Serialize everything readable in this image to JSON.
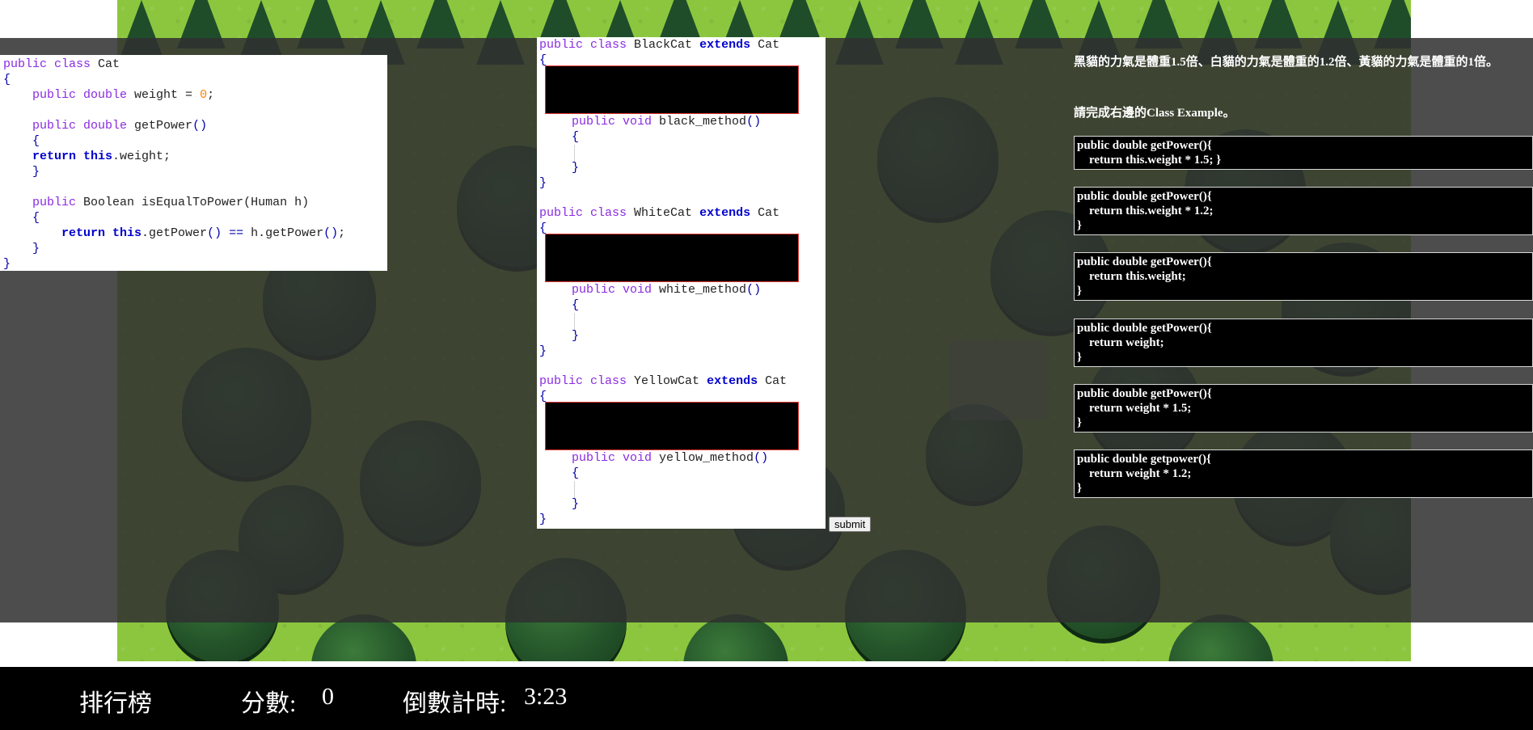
{
  "base_class": {
    "lines": [
      {
        "parts": [
          {
            "t": "public class ",
            "c": "kw"
          },
          {
            "t": "Cat",
            "c": ""
          }
        ]
      },
      {
        "parts": [
          {
            "t": "{",
            "c": "brace"
          }
        ]
      },
      {
        "parts": [
          {
            "t": "    ",
            "c": ""
          },
          {
            "t": "public double ",
            "c": "kw"
          },
          {
            "t": "weight = ",
            "c": ""
          },
          {
            "t": "0",
            "c": "num"
          },
          {
            "t": ";",
            "c": ""
          }
        ]
      },
      {
        "parts": [
          {
            "t": "",
            "c": ""
          }
        ]
      },
      {
        "parts": [
          {
            "t": "    ",
            "c": ""
          },
          {
            "t": "public double ",
            "c": "kw"
          },
          {
            "t": "getPower",
            "c": ""
          },
          {
            "t": "()",
            "c": "brace"
          }
        ]
      },
      {
        "parts": [
          {
            "t": "    ",
            "c": ""
          },
          {
            "t": "{",
            "c": "brace"
          }
        ]
      },
      {
        "parts": [
          {
            "t": "    ",
            "c": ""
          },
          {
            "t": "return this",
            "c": "kw2"
          },
          {
            "t": ".weight;",
            "c": ""
          }
        ]
      },
      {
        "parts": [
          {
            "t": "    ",
            "c": ""
          },
          {
            "t": "}",
            "c": "brace"
          }
        ]
      },
      {
        "parts": [
          {
            "t": "",
            "c": ""
          }
        ]
      },
      {
        "parts": [
          {
            "t": "    ",
            "c": ""
          },
          {
            "t": "public ",
            "c": "kw"
          },
          {
            "t": "Boolean isEqualToPower(Human h)",
            "c": ""
          }
        ]
      },
      {
        "parts": [
          {
            "t": "    ",
            "c": ""
          },
          {
            "t": "{",
            "c": "brace"
          }
        ]
      },
      {
        "parts": [
          {
            "t": "        ",
            "c": ""
          },
          {
            "t": "return this",
            "c": "kw2"
          },
          {
            "t": ".getPower",
            "c": ""
          },
          {
            "t": "()",
            "c": "brace"
          },
          {
            "t": " ",
            "c": ""
          },
          {
            "t": "==",
            "c": "brace"
          },
          {
            "t": " h.getPower",
            "c": ""
          },
          {
            "t": "()",
            "c": "brace"
          },
          {
            "t": ";",
            "c": ""
          }
        ]
      },
      {
        "parts": [
          {
            "t": "    ",
            "c": ""
          },
          {
            "t": "}",
            "c": "brace"
          }
        ]
      },
      {
        "parts": [
          {
            "t": "}",
            "c": "brace"
          }
        ]
      }
    ]
  },
  "subclasses": [
    {
      "class_kw": "public class ",
      "name": "BlackCat",
      "extends_kw": "extends",
      "parent": "Cat",
      "method_kw": "public void ",
      "method": "black_method",
      "parens": "()"
    },
    {
      "class_kw": "public class ",
      "name": "WhiteCat",
      "extends_kw": "extends",
      "parent": "Cat",
      "method_kw": "public void ",
      "method": "white_method",
      "parens": "()"
    },
    {
      "class_kw": "public class ",
      "name": "YellowCat",
      "extends_kw": "extends",
      "parent": "Cat",
      "method_kw": "public void ",
      "method": "yellow_method",
      "parens": "()"
    }
  ],
  "submit_label": "submit",
  "instructions": {
    "description": "黑貓的力氣是體重1.5倍、白貓的力氣是體重的1.2倍、黃貓的力氣是體重的1倍。",
    "task": "請完成右邊的Class Example。"
  },
  "options": [
    {
      "lines": [
        "public double getPower(){",
        "    return this.weight * 1.5; }"
      ]
    },
    {
      "lines": [
        "public double getPower(){",
        "    return this.weight * 1.2;",
        "}"
      ]
    },
    {
      "lines": [
        "public double getPower(){",
        "    return this.weight;",
        "}"
      ]
    },
    {
      "lines": [
        "public double getPower(){",
        "    return weight;",
        "}"
      ]
    },
    {
      "lines": [
        "public double getPower(){",
        "    return weight * 1.5;",
        "}"
      ]
    },
    {
      "lines": [
        "public double getpower(){",
        "    return weight * 1.2;",
        "}"
      ]
    }
  ],
  "bottom_bar": {
    "leaderboard_label": "排行榜",
    "score_label": "分數:",
    "score_value": "0",
    "countdown_label": "倒數計時:",
    "countdown_value": "3:23"
  },
  "colors": {
    "overlay": "#303030",
    "keyword": "#8a2be2",
    "keyword_bold": "#0000cc",
    "number": "#ff7f00",
    "drop_zone_border": "#e53333"
  }
}
